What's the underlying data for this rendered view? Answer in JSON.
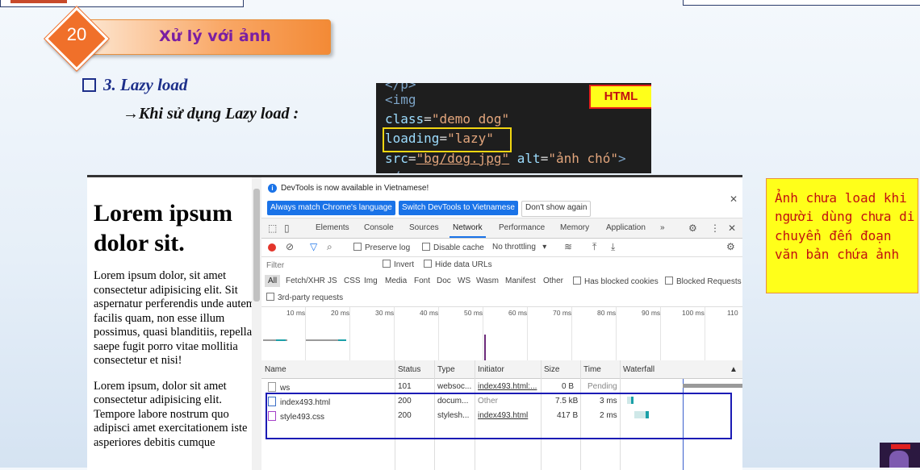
{
  "slide": {
    "number": "20",
    "title": "Xử lý với ảnh",
    "bullet": "3. Lazy load",
    "sub": "Khi sử dụng Lazy load :",
    "sub_arrow": "→"
  },
  "code": {
    "lines": [
      "<img",
      "class=\"demo dog\"",
      "loading=\"lazy\"",
      "src=\"bg/dog.jpg\" alt=\"ảnh chó\">"
    ],
    "tag_label": "HTML"
  },
  "note": "Ảnh chưa load khi người dùng chưa di chuyển đến đoạn văn bản chứa ảnh",
  "page": {
    "heading": "Lorem ipsum dolor sit.",
    "paragraphs": [
      "Lorem ipsum dolor, sit amet consectetur adipisicing elit. Sit aspernatur perferendis unde autem facilis quam, non esse illum possimus, quasi blanditiis, repellat saepe fugit porro vitae mollitia consectetur et nisi!",
      "Lorem ipsum, dolor sit amet consectetur adipisicing elit. Tempore labore nostrum quo adipisci amet exercitationem iste asperiores debitis cumque"
    ]
  },
  "devtools": {
    "notice": "DevTools is now available in Vietnamese!",
    "btn_always": "Always match Chrome's language",
    "btn_switch": "Switch DevTools to Vietnamese",
    "btn_dont": "Don't show again",
    "tabs": [
      "Elements",
      "Console",
      "Sources",
      "Network",
      "Performance",
      "Memory",
      "Application"
    ],
    "tabs_more": "»",
    "active_tab": "Network",
    "toolbar": {
      "preserve_log": "Preserve log",
      "disable_cache": "Disable cache",
      "throttling": "No throttling"
    },
    "filter_placeholder": "Filter",
    "invert": "Invert",
    "hide_data_urls": "Hide data URLs",
    "types": [
      "All",
      "Fetch/XHR",
      "JS",
      "CSS",
      "Img",
      "Media",
      "Font",
      "Doc",
      "WS",
      "Wasm",
      "Manifest",
      "Other"
    ],
    "has_blocked_cookies": "Has blocked cookies",
    "blocked_requests": "Blocked Requests",
    "third_party": "3rd-party requests",
    "ticks": [
      "10 ms",
      "20 ms",
      "30 ms",
      "40 ms",
      "50 ms",
      "60 ms",
      "70 ms",
      "80 ms",
      "90 ms",
      "100 ms",
      "110"
    ],
    "columns": [
      "Name",
      "Status",
      "Type",
      "Initiator",
      "Size",
      "Time",
      "Waterfall"
    ],
    "rows": [
      {
        "name": "ws",
        "status": "101",
        "type": "websoc...",
        "initiator": "index493.html:...",
        "size": "0 B",
        "time": "Pending"
      },
      {
        "name": "index493.html",
        "status": "200",
        "type": "docum...",
        "initiator": "Other",
        "size": "7.5 kB",
        "time": "3 ms"
      },
      {
        "name": "style493.css",
        "status": "200",
        "type": "stylesh...",
        "initiator": "index493.html",
        "size": "417 B",
        "time": "2 ms"
      }
    ]
  },
  "colors": {
    "accent_orange": "#f0702a",
    "title_purple": "#7a1fa2",
    "bullet_blue": "#1d2f8a",
    "note_yellow": "#ffff1a",
    "note_red": "#c21010",
    "highlight_box_blue": "#1b1bb5"
  }
}
